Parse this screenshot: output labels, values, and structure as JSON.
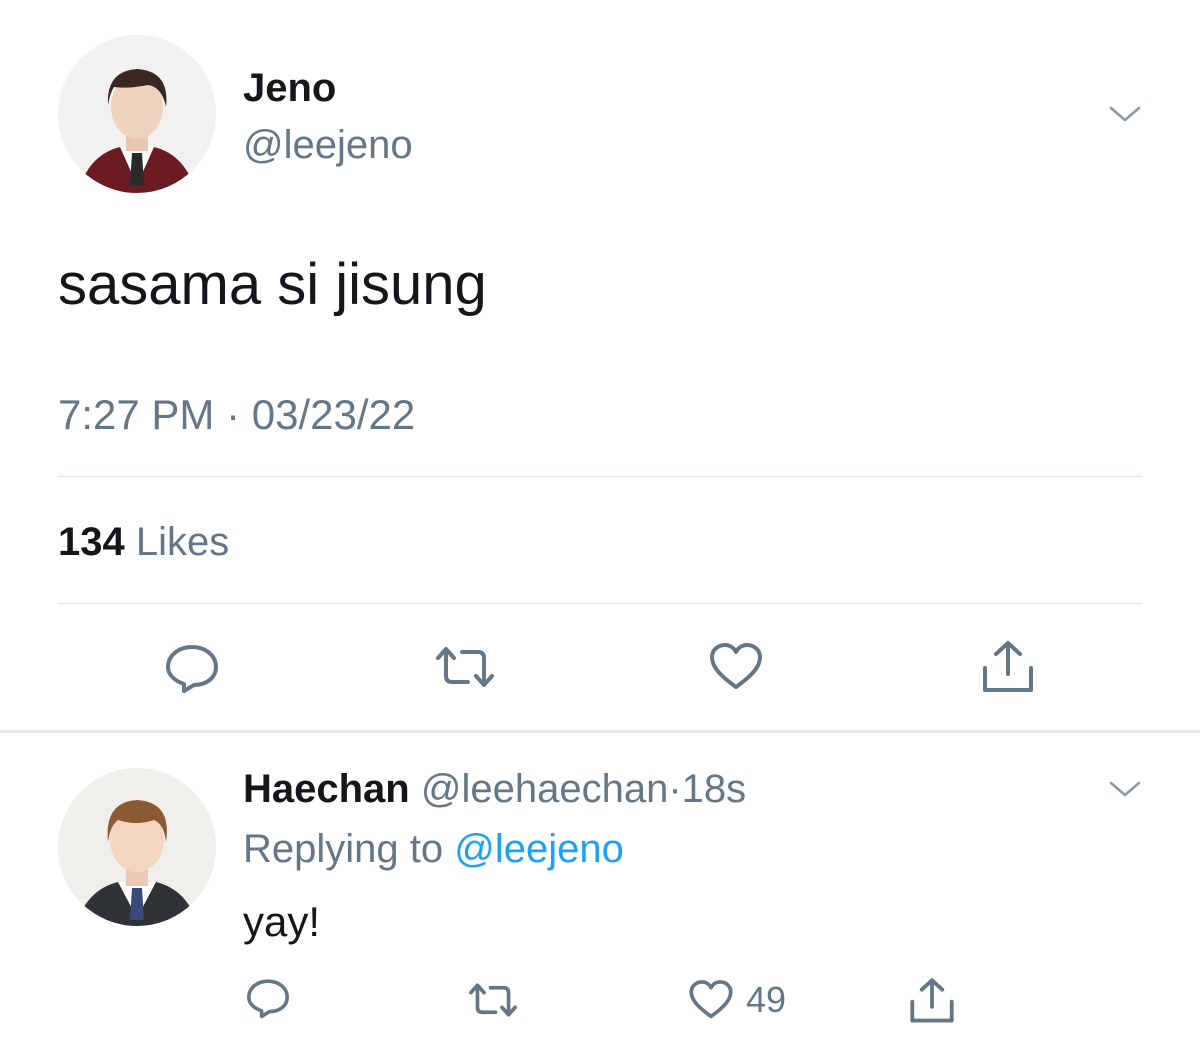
{
  "tweet": {
    "author": {
      "name": "Jeno",
      "handle": "@leejeno"
    },
    "text": "sasama si jisung",
    "time": "7:27 PM",
    "separator": "·",
    "date": "03/23/22",
    "likes_count": "134",
    "likes_label": "Likes",
    "icons": [
      "reply-icon",
      "retweet-icon",
      "like-icon",
      "share-icon",
      "chevron-down-icon"
    ]
  },
  "reply": {
    "author": {
      "name": "Haechan",
      "handle": "@leehaechan"
    },
    "separator": "·",
    "age": "18s",
    "replying_prefix": "Replying to",
    "replying_handle": "@leejeno",
    "text": "yay!",
    "like_count": "49",
    "icons": [
      "reply-icon",
      "retweet-icon",
      "like-icon",
      "share-icon",
      "chevron-down-icon"
    ]
  },
  "colors": {
    "text": "#14171a",
    "muted": "#657786",
    "link": "#1da1f2",
    "divider": "#e1e8ed"
  }
}
